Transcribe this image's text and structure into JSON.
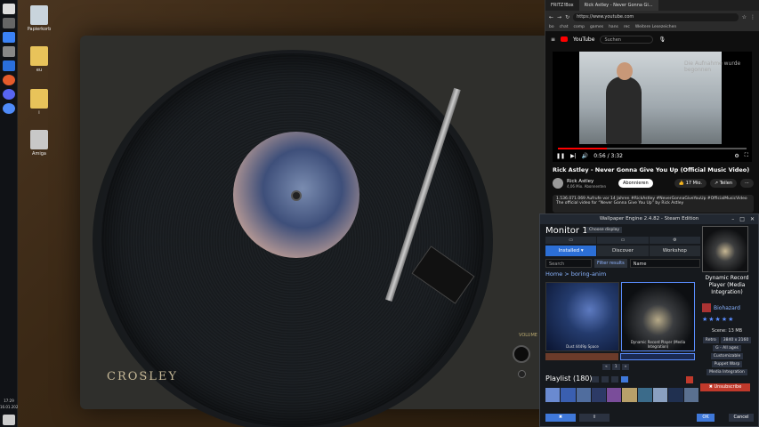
{
  "taskbar": {
    "time": "17:29",
    "date": "16.01.2024"
  },
  "desktop": {
    "icons": [
      {
        "label": "Papierkorb"
      },
      {
        "label": "eu"
      },
      {
        "label": "i"
      },
      {
        "label": "Amiga"
      }
    ],
    "wallpaper_brand": "CROSLEY",
    "volume_label": "VOLUME"
  },
  "browser": {
    "tabs": [
      {
        "label": "FRITZ!Box"
      },
      {
        "label": "Rick Astley - Never Gonna Gi..."
      }
    ],
    "url": "https://www.youtube.com",
    "bookmarks": [
      "bo",
      "chat",
      "comp",
      "games",
      "hans",
      "rec",
      "Weitere Lesezeichen"
    ],
    "yt": {
      "logo_text": "YouTube",
      "search_placeholder": "Suchen",
      "recording_note": "Die Aufnahme wurde begonnen",
      "time_display": "0:56 / 3:32",
      "progress": 0.26,
      "title": "Rick Astley - Never Gonna Give You Up (Official Music Video)",
      "channel": "Rick Astley",
      "subscribers": "4,06 Mio. Abonnenten",
      "subscribe_label": "Abonnieren",
      "likes": "17 Mio.",
      "share_label": "Teilen",
      "desc_line1": "1.536.071.069 Aufrufe  vor 14 Jahren  #RickAstley #NeverGonnaGiveYouUp #OfficialMusicVideo",
      "desc_line2": "The official video for “Never Gonna Give You Up” by Rick Astley"
    }
  },
  "wallpaper_engine": {
    "title": "Wallpaper Engine 2.4.82 - Steam Edition",
    "monitor": "Monitor 1",
    "choose_display": "Choose display",
    "tabs": [
      {
        "label": "Installed ▾",
        "active": true
      },
      {
        "label": "Discover",
        "active": false
      },
      {
        "label": "Workshop",
        "active": false
      }
    ],
    "search_placeholder": "Search",
    "filter_label": "Filter results",
    "sort_label": "Name",
    "breadcrumb": "Home > boring-anim",
    "wallpapers": [
      {
        "caption": "Dust 4449p Space"
      },
      {
        "caption": "Dynamic Record Player (Media Integration)"
      }
    ],
    "pager": [
      "«",
      "1",
      "»"
    ],
    "playlist_label": "Playlist (180)",
    "preview": {
      "name": "Dynamic Record Player (Media Integration)",
      "author": "Biohazard",
      "stars": "★★★★★",
      "size": "Scene: 13 MB",
      "tags": [
        "Retro",
        "3840 x 2160",
        "G - All ages",
        "Customizable",
        "Puppet Warp",
        "Media Integration"
      ],
      "unsubscribe_label": "✖ Unsubscribe"
    },
    "ok_label": "OK",
    "cancel_label": "Cancel"
  }
}
